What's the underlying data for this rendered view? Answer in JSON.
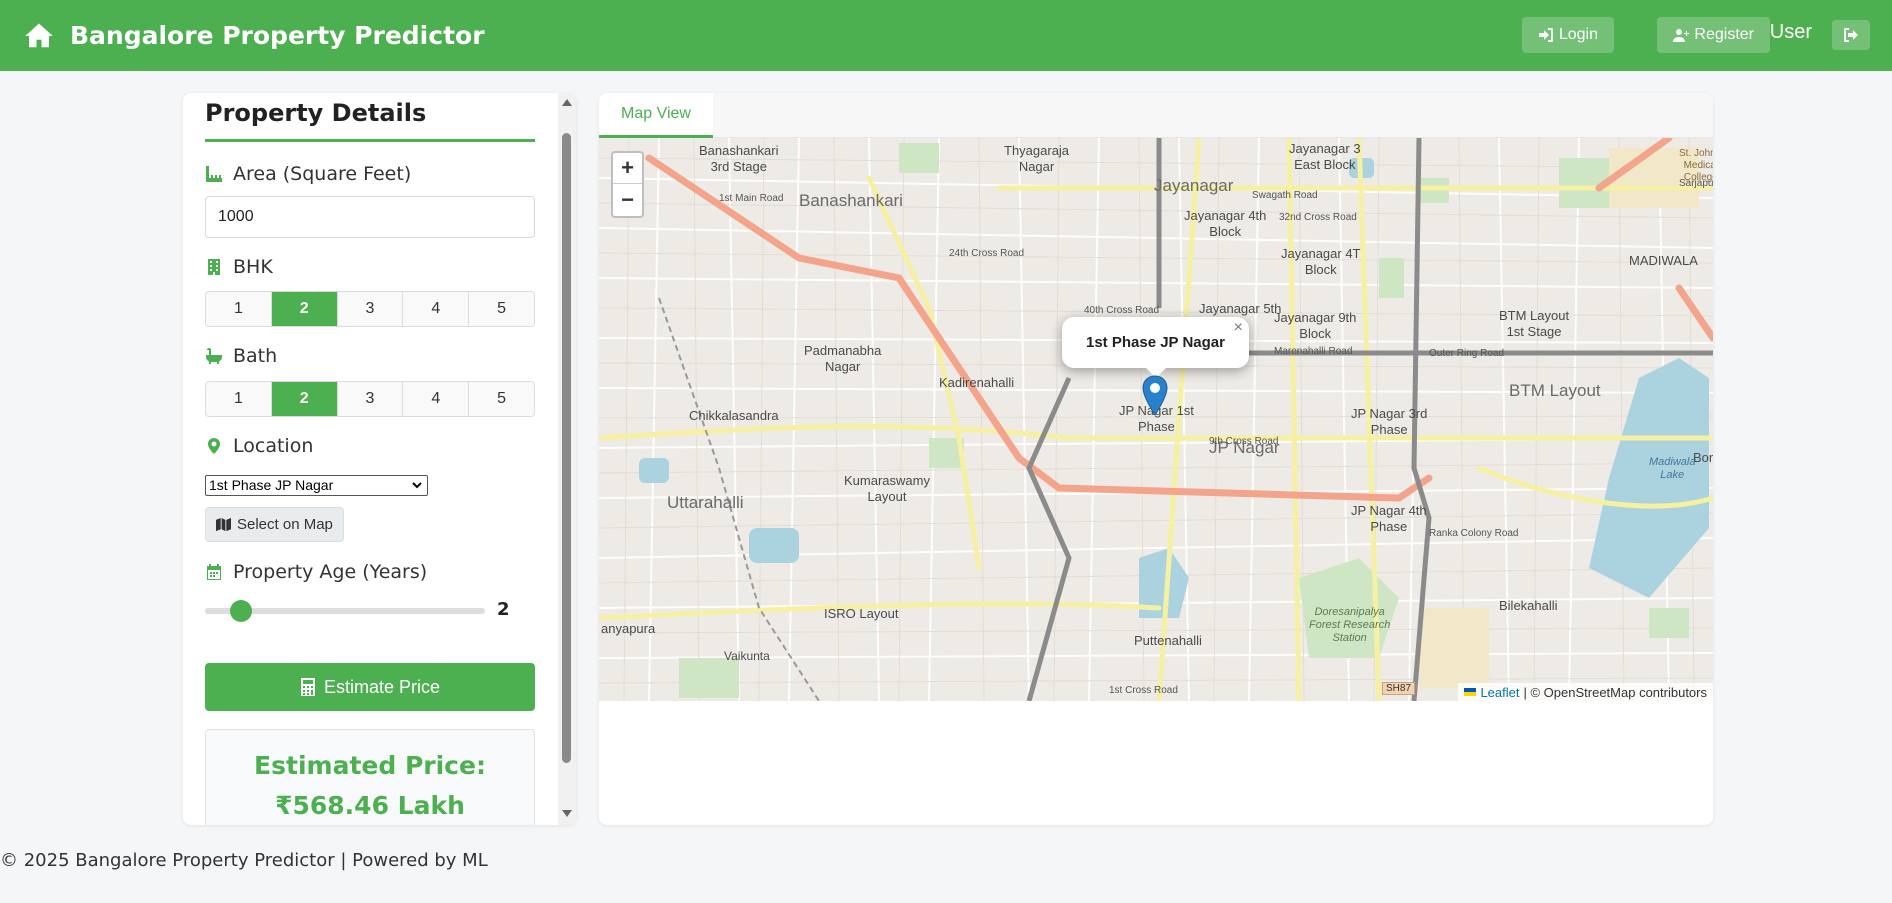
{
  "header": {
    "title": "Bangalore Property Predictor",
    "login_label": "Login",
    "register_label": "Register",
    "user_label": "User",
    "accent_color": "#4caf50"
  },
  "form": {
    "title": "Property Details",
    "area_label": "Area (Square Feet)",
    "area_value": "1000",
    "bhk_label": "BHK",
    "bhk_options": [
      "1",
      "2",
      "3",
      "4",
      "5"
    ],
    "bhk_selected": "2",
    "bath_label": "Bath",
    "bath_options": [
      "1",
      "2",
      "3",
      "4",
      "5"
    ],
    "bath_selected": "2",
    "location_label": "Location",
    "location_value": "1st Phase JP Nagar",
    "select_on_map_label": "Select on Map",
    "age_label": "Property Age (Years)",
    "age_value": "2",
    "age_fraction": 0.13,
    "estimate_label": "Estimate Price",
    "result_line1": "Estimated Price:",
    "result_line2": "₹568.46 Lakh"
  },
  "map": {
    "tab_label": "Map View",
    "zoom_in": "+",
    "zoom_out": "−",
    "popup_text": "1st Phase JP Nagar",
    "popup_close": "×",
    "attribution_leaflet": "Leaflet",
    "attribution_osm": "| © OpenStreetMap contributors",
    "places": {
      "banashankari": "Banashankari",
      "banashankari3": "Banashankari\n3rd Stage",
      "thyagaraja": "Thyagaraja\nNagar",
      "jayanagar": "Jayanagar",
      "jayanagar3": "Jayanagar 3\nEast Block",
      "jayanagar4": "Jayanagar 4th\nBlock",
      "jayanagar4t": "Jayanagar 4T\nBlock",
      "jayanagar5": "Jayanagar 5th",
      "jayanagar9": "Jayanagar 9th\nBlock",
      "madhiwala": "MADIWALA",
      "btm1": "BTM Layout\n1st Stage",
      "btm": "BTM Layout",
      "padmanabha": "Padmanabha\nNagar",
      "kadirenahalli": "Kadirenahalli",
      "chikkalasandra": "Chikkalasandra",
      "jpnagar1": "JP Nagar 1st\nPhase",
      "jpnagar": "JP Nagar",
      "jpnagar3": "JP Nagar 3rd\nPhase",
      "jpnagar4": "JP Nagar 4th\nPhase",
      "uttarahalli": "Uttarahalli",
      "kumaraswamy": "Kumaraswamy\nLayout",
      "isro": "ISRO Layout",
      "puttenahalli": "Puttenahalli",
      "bilekahalli": "Bilekahalli",
      "doresani": "Doresanipalya\nForest Research\nStation",
      "madiwala_lake": "Madiwala\nLake",
      "vaikunta": "Vaikunta",
      "anyapura": "anyapura",
      "stjohns": "St. John's\nMedical\nCollege",
      "bon": "Bon"
    },
    "roads": {
      "outer_ring": "Outer Ring Road",
      "marenahalli": "Marenahalli Road",
      "ninth_cross": "9th Cross Road",
      "fortieth_cross": "40th Cross Road",
      "swagath": "Swagath Road",
      "thirty2_cross": "32nd Cross Road",
      "twentyfourth_cross": "24th Cross Road",
      "ranka": "Ranka Colony Road",
      "first_cross": "1st Cross Road",
      "sarjapura": "Sarjapura Road",
      "first_main": "1st Main Road",
      "sh87": "SH87"
    }
  },
  "footer": {
    "text": "© 2025 Bangalore Property Predictor | Powered by ML"
  }
}
